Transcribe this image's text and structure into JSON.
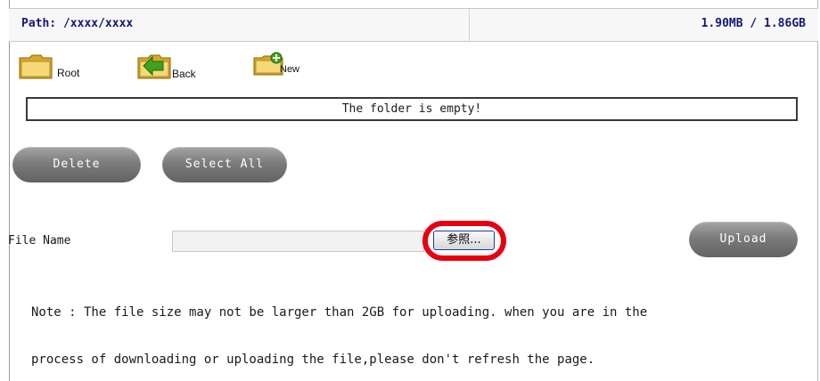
{
  "header": {
    "path": "Path: /xxxx/xxxx",
    "usage": "1.90MB / 1.86GB"
  },
  "toolbar": {
    "root_label": "Root",
    "back_label": "Back",
    "new_label": "New"
  },
  "message": "The folder is empty!",
  "actions": {
    "delete_label": "Delete",
    "select_all_label": "Select All"
  },
  "upload_form": {
    "file_name_label": "File Name",
    "browse_label": "参照...",
    "upload_label": "Upload"
  },
  "note": {
    "line1": "Note : The file size may not be larger than 2GB for uploading. when you are in the",
    "line2": "process of downloading or uploading the file,please don't refresh the page."
  },
  "colors": {
    "header_text": "#14187a",
    "highlight_ring": "#e60012",
    "button_gray": "#7c7c7c"
  }
}
